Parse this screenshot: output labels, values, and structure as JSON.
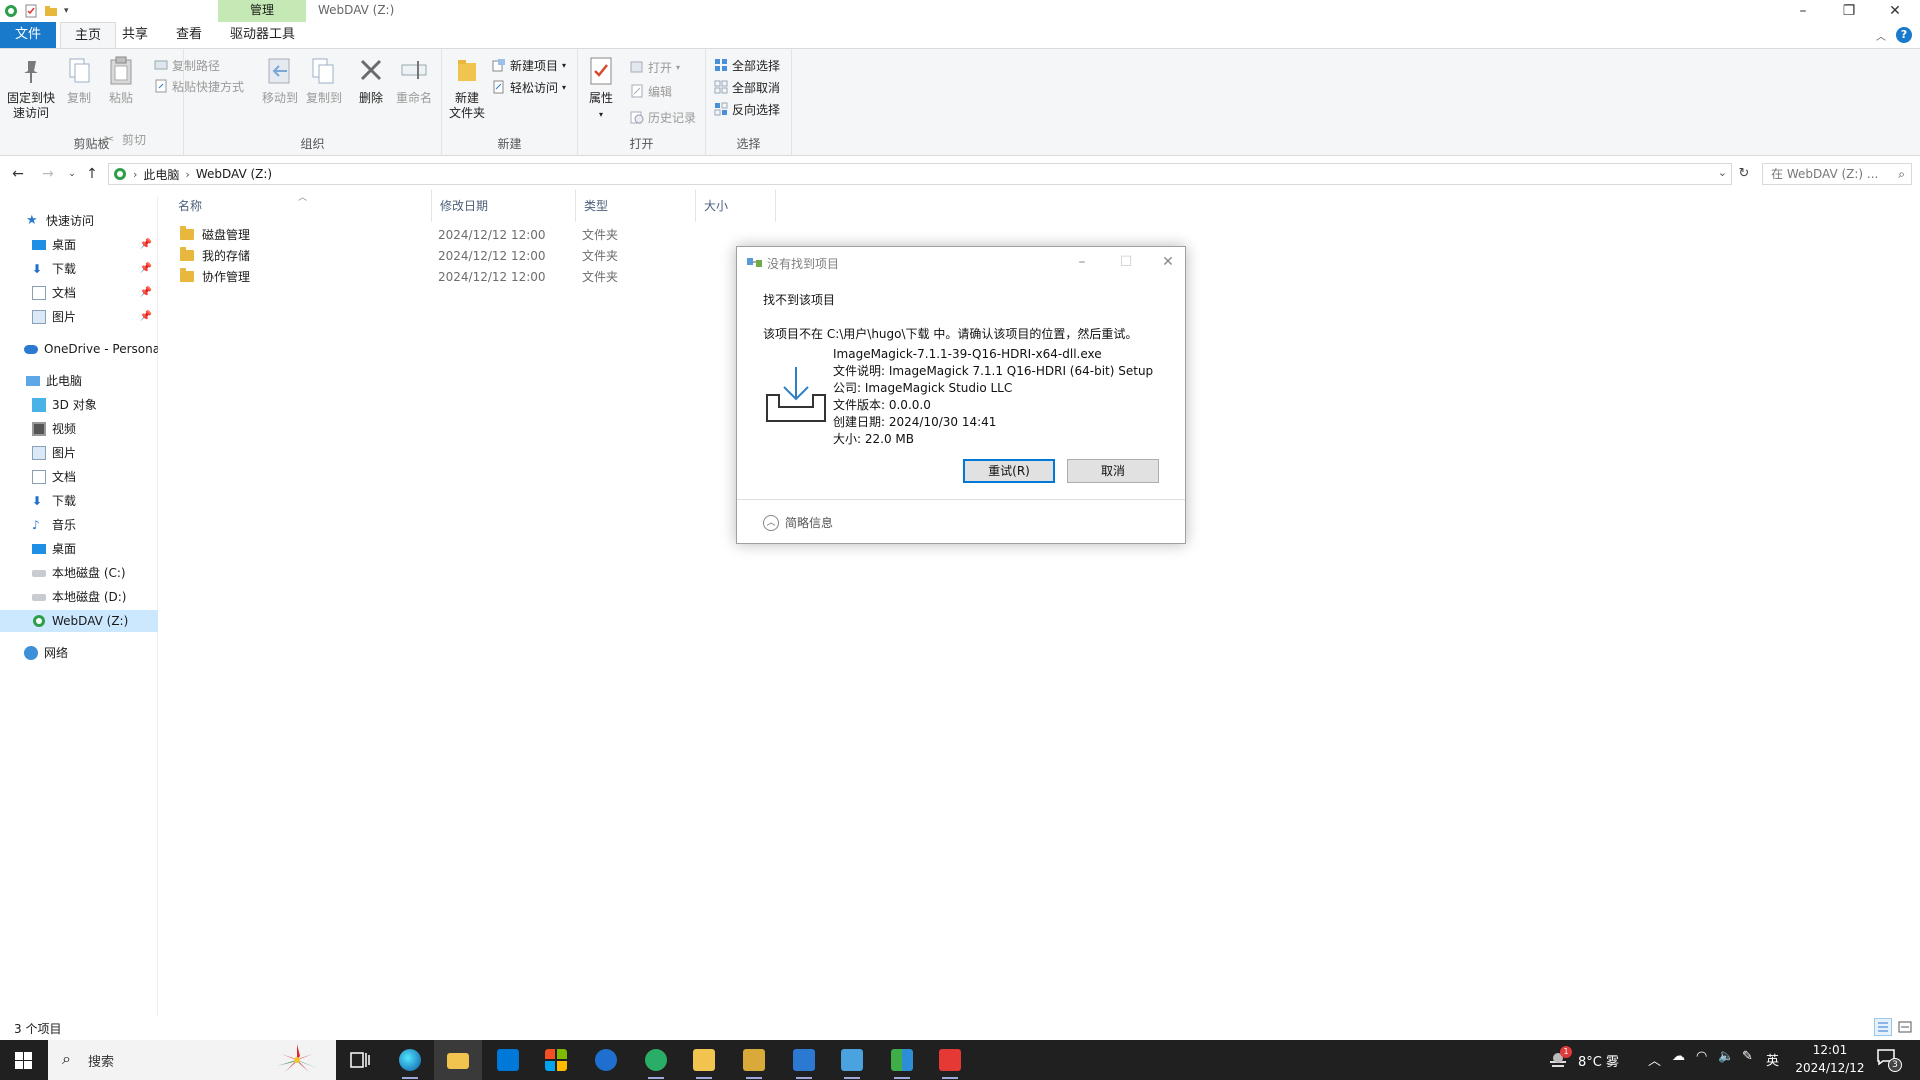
{
  "window": {
    "title": "WebDAV (Z:)",
    "context_tab_top": "管理"
  },
  "ribbon_tabs": [
    "文件",
    "主页",
    "共享",
    "查看",
    "驱动器工具"
  ],
  "ribbon": {
    "clipboard": {
      "pin_line1": "固定到快",
      "pin_line2": "速访问",
      "copy": "复制",
      "paste": "粘贴",
      "copy_path": "复制路径",
      "paste_shortcut": "粘贴快捷方式",
      "cut": "剪切",
      "label": "剪贴板"
    },
    "organize": {
      "move_to": "移动到",
      "copy_to": "复制到",
      "delete": "删除",
      "rename": "重命名",
      "label": "组织"
    },
    "new": {
      "new_folder_line1": "新建",
      "new_folder_line2": "文件夹",
      "new_item": "新建项目",
      "easy_access": "轻松访问",
      "label": "新建"
    },
    "open": {
      "properties": "属性",
      "open": "打开",
      "edit": "编辑",
      "history": "历史记录",
      "label": "打开"
    },
    "select": {
      "select_all": "全部选择",
      "select_none": "全部取消",
      "invert": "反向选择",
      "label": "选择"
    }
  },
  "address": {
    "crumbs": [
      "此电脑",
      "WebDAV (Z:)"
    ],
    "search_placeholder": "在 WebDAV (Z:) ..."
  },
  "nav": {
    "quick_access": "快速访问",
    "quick_items": [
      "桌面",
      "下载",
      "文档",
      "图片"
    ],
    "onedrive": "OneDrive - Persona",
    "this_pc": "此电脑",
    "pc_items": [
      "3D 对象",
      "视频",
      "图片",
      "文档",
      "下载",
      "音乐",
      "桌面",
      "本地磁盘 (C:)",
      "本地磁盘 (D:)",
      "WebDAV (Z:)"
    ],
    "network": "网络"
  },
  "columns": {
    "name": "名称",
    "modified": "修改日期",
    "type": "类型",
    "size": "大小"
  },
  "files": [
    {
      "name": "磁盘管理",
      "modified": "2024/12/12 12:00",
      "type": "文件夹"
    },
    {
      "name": "我的存储",
      "modified": "2024/12/12 12:00",
      "type": "文件夹"
    },
    {
      "name": "协作管理",
      "modified": "2024/12/12 12:00",
      "type": "文件夹"
    }
  ],
  "status": {
    "count": "3 个项目"
  },
  "dialog": {
    "title": "没有找到项目",
    "heading": "找不到该项目",
    "message": "该项目不在 C:\\用户\\hugo\\下载 中。请确认该项目的位置，然后重试。",
    "file_name": "ImageMagick-7.1.1-39-Q16-HDRI-x64-dll.exe",
    "description": "文件说明: ImageMagick 7.1.1 Q16-HDRI (64-bit) Setup",
    "company": "公司: ImageMagick Studio LLC",
    "version": "文件版本: 0.0.0.0",
    "created": "创建日期: 2024/10/30 14:41",
    "size": "大小: 22.0 MB",
    "retry": "重试(R)",
    "cancel": "取消",
    "less_info": "简略信息"
  },
  "taskbar": {
    "search": "搜索",
    "weather": "8°C 雾",
    "ime": "英",
    "time": "12:01",
    "date": "2024/12/12",
    "notification_count": "3",
    "weather_badge": "1"
  }
}
